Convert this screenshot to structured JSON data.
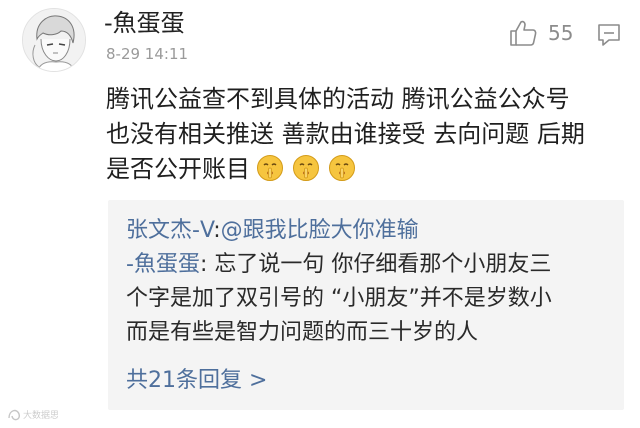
{
  "comment": {
    "username": "-魚蛋蛋",
    "timestamp": "8-29 14:11",
    "like_count": "55",
    "body_lines": [
      "腾讯公益查不到具体的活动  腾讯公益公众号",
      "也没有相关推送  善款由谁接受  去向问题  后期",
      "是否公开账目"
    ],
    "trailing_emoji": "shush-face-icon"
  },
  "replies": [
    {
      "author": "张文杰-V",
      "separator": ":",
      "text": "@跟我比脸大你准输"
    },
    {
      "author": "-魚蛋蛋",
      "separator": ":",
      "lines": [
        " 忘了说一句  你仔细看那个小朋友三",
        "个字是加了双引号的 “小朋友”并不是岁数小",
        "而是有些是智力问题的而三十岁的人"
      ]
    }
  ],
  "view_all_replies": "共21条回复 >",
  "watermark": "大数据思维",
  "colors": {
    "link": "#4e6f9c",
    "text": "#1f1f1f",
    "meta": "#9a9a9a",
    "reply_bg": "#f4f4f4"
  }
}
